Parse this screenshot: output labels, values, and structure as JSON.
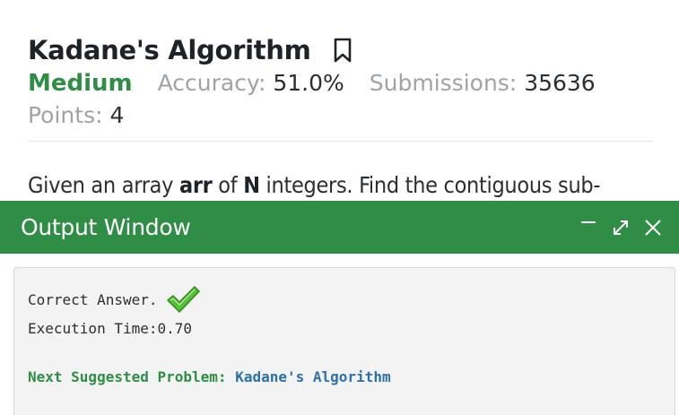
{
  "problem": {
    "title": "Kadane's Algorithm",
    "difficulty": "Medium",
    "accuracy_label": "Accuracy:",
    "accuracy_value": "51.0%",
    "submissions_label": "Submissions:",
    "submissions_value": "35636",
    "points_label": "Points:",
    "points_value": "4",
    "statement_pre": "Given an array ",
    "statement_arr": "arr",
    "statement_mid": " of ",
    "statement_n": "N",
    "statement_post": " integers. Find the contiguous sub-"
  },
  "output_window": {
    "title": "Output Window",
    "result_text": "Correct Answer.",
    "execution_time": "Execution Time:0.70",
    "next_label": "Next Suggested Problem:",
    "next_link": "Kadane's Algorithm"
  },
  "icons": {
    "bookmark": "bookmark-icon",
    "minimize": "minimize-icon",
    "expand": "expand-icon",
    "close": "close-icon",
    "check": "check-icon"
  },
  "colors": {
    "accent_green": "#2f8d46",
    "link_blue": "#2e6faa",
    "muted_gray": "#9fa3a8"
  }
}
